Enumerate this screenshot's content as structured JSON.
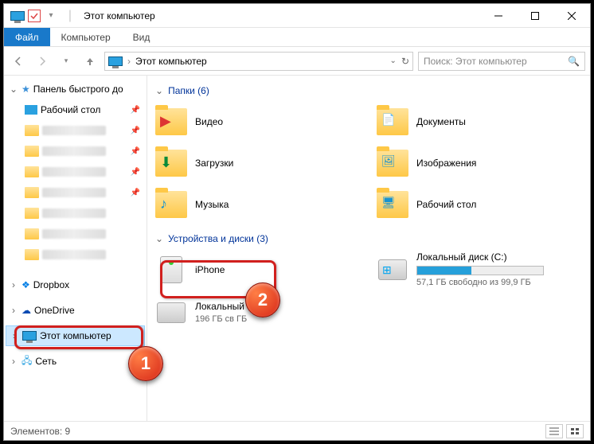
{
  "titlebar": {
    "title": "Этот компьютер"
  },
  "ribbon": {
    "file": "Файл",
    "computer": "Компьютер",
    "view": "Вид"
  },
  "address": {
    "crumb": "Этот компьютер"
  },
  "search": {
    "placeholder": "Поиск: Этот компьютер"
  },
  "sidebar": {
    "quick": "Панель быстрого до",
    "desktop": "Рабочий стол",
    "dropbox": "Dropbox",
    "onedrive": "OneDrive",
    "thispc": "Этот компьютер",
    "network": "Сеть"
  },
  "sections": {
    "folders_h": "Папки (6)",
    "devices_h": "Устройства и диски (3)"
  },
  "folders": [
    {
      "name": "Видео"
    },
    {
      "name": "Документы"
    },
    {
      "name": "Загрузки"
    },
    {
      "name": "Изображения"
    },
    {
      "name": "Музыка"
    },
    {
      "name": "Рабочий стол"
    }
  ],
  "devices": {
    "iphone": {
      "name": "iPhone"
    },
    "diskc": {
      "name": "Локальный диск (C:)",
      "info": "57,1 ГБ свободно из 99,9 ГБ",
      "fill_pct": 43
    },
    "diskd": {
      "name": "Локальный",
      "info": "196 ГБ св                     ГБ"
    }
  },
  "status": {
    "count": "Элементов: 9"
  },
  "callouts": {
    "n1": "1",
    "n2": "2"
  }
}
